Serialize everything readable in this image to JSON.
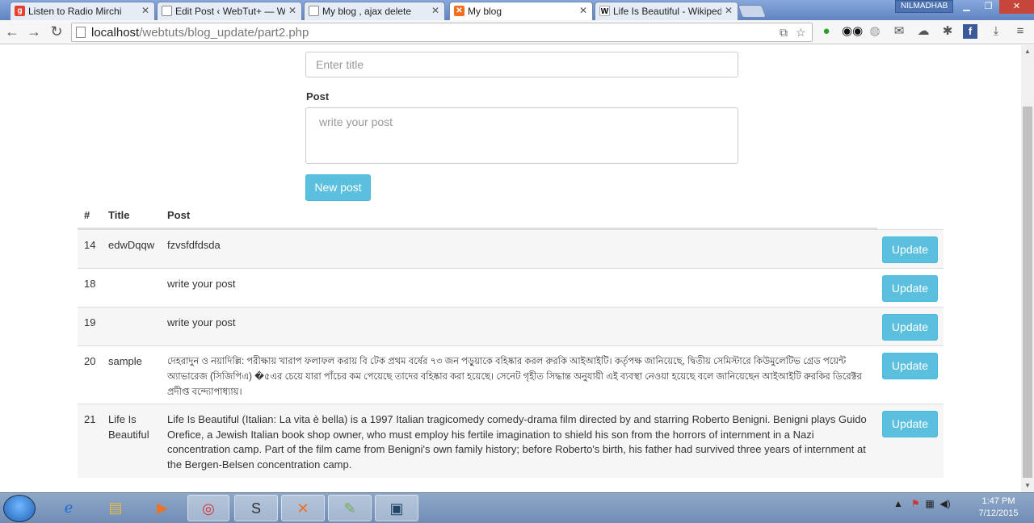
{
  "browser": {
    "tabs": [
      {
        "label": "Listen to Radio Mirchi",
        "favicon": "radio-mirchi-icon",
        "active": false
      },
      {
        "label": "Edit Post ‹ WebTut+ — W",
        "favicon": "page-icon",
        "active": false
      },
      {
        "label": "My blog , ajax delete",
        "favicon": "page-icon",
        "active": false
      },
      {
        "label": "My blog",
        "favicon": "xampp-icon",
        "active": true
      },
      {
        "label": "Life Is Beautiful - Wikipedi",
        "favicon": "wikipedia-icon",
        "active": false
      }
    ],
    "user": "NILMADHAB",
    "url_host": "localhost",
    "url_path": "/webtuts/blog_update/part2.php"
  },
  "form": {
    "title_placeholder": "Enter title",
    "post_label": "Post",
    "post_placeholder": "write your post",
    "new_post_label": "New post"
  },
  "table": {
    "headers": {
      "id": "#",
      "title": "Title",
      "post": "Post"
    },
    "update_label": "Update",
    "rows": [
      {
        "id": "14",
        "title": "edwDqqw",
        "post": "fzvsfdfdsda"
      },
      {
        "id": "18",
        "title": "",
        "post": "write your post"
      },
      {
        "id": "19",
        "title": "",
        "post": "write your post"
      },
      {
        "id": "20",
        "title": "sample",
        "post": "দেহরাদুন ও নয়াদিল্লি: পরীক্ষায় খারাপ ফলাফল করায় বি টেক প্রথম বর্ষের ৭৩ জন পড়ুয়াকে বহিষ্কার করল রুরকি আইআইটি। কর্তৃপক্ষ জানিয়েছে, দ্বিতীয় সেমিস্টারে কিউমুলেটিভ গ্রেড পয়েন্ট অ্যাভারেজ (সিজিপিএ) �৫এর চেয়ে যারা পাঁচের কম পেয়েছে তাদের বহিষ্কার করা হয়েছে। সেনেট গৃহীত সিদ্ধান্ত অনুযায়ী এই ব্যবস্থা নেওয়া হয়েছে বলে জানিয়েছেন আইআইটি রুরকির ডিরেক্টর প্রদীপ্ত বন্দ্যোপাধ্যায়।"
      },
      {
        "id": "21",
        "title": "Life Is Beautiful",
        "post": "Life Is Beautiful (Italian: La vita è bella) is a 1997 Italian tragicomedy comedy-drama film directed by and starring Roberto Benigni. Benigni plays Guido Orefice, a Jewish Italian book shop owner, who must employ his fertile imagination to shield his son from the horrors of internment in a Nazi concentration camp. Part of the film came from Benigni's own family history; before Roberto's birth, his father had survived three years of internment at the Bergen-Belsen concentration camp."
      }
    ]
  },
  "taskbar": {
    "time": "1:47 PM",
    "date": "7/12/2015"
  },
  "colors": {
    "info_button": "#5bc0de",
    "stripe": "#f6f6f6"
  }
}
